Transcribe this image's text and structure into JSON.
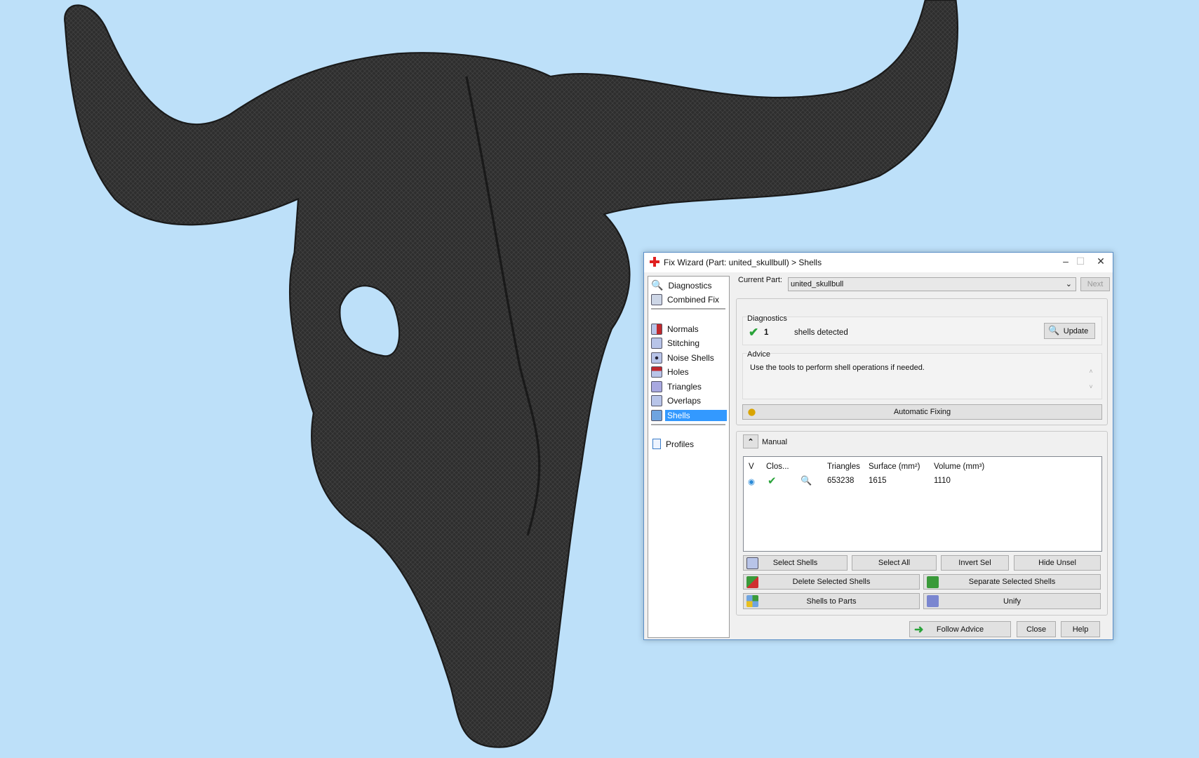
{
  "window": {
    "title": "Fix Wizard (Part: united_skullbull) > Shells",
    "minimize": "–",
    "maximize": "☐",
    "close": "✕"
  },
  "sidebar": {
    "items": [
      {
        "label": "Diagnostics",
        "icon": "magnifier-icon"
      },
      {
        "label": "Combined Fix",
        "icon": "cube-icon"
      },
      {
        "label": "Normals",
        "icon": "normals-icon"
      },
      {
        "label": "Stitching",
        "icon": "stitching-icon"
      },
      {
        "label": "Noise Shells",
        "icon": "noise-shells-icon"
      },
      {
        "label": "Holes",
        "icon": "holes-icon"
      },
      {
        "label": "Triangles",
        "icon": "triangles-icon"
      },
      {
        "label": "Overlaps",
        "icon": "overlaps-icon"
      },
      {
        "label": "Shells",
        "icon": "shells-icon",
        "selected": true
      },
      {
        "label": "Profiles",
        "icon": "document-icon"
      }
    ]
  },
  "header": {
    "current_part_label": "Current Part:",
    "current_part_value": "united_skullbull",
    "next": "Next"
  },
  "diagnostics": {
    "legend": "Diagnostics",
    "count": "1",
    "text": "shells detected",
    "update": "Update"
  },
  "advice": {
    "legend": "Advice",
    "text": "Use the tools to perform shell operations if needed."
  },
  "automatic_fixing": "Automatic Fixing",
  "manual": {
    "label": "Manual",
    "columns": [
      "V",
      "Clos...",
      "",
      "Triangles",
      "Surface (mm²)",
      "Volume (mm³)"
    ],
    "rows": [
      {
        "visible": true,
        "closed": true,
        "triangles": "653238",
        "surface": "1615",
        "volume": "1110"
      }
    ]
  },
  "buttons": {
    "select_shells": "Select Shells",
    "select_all": "Select All",
    "invert_sel": "Invert Sel",
    "hide_unsel": "Hide Unsel",
    "delete_selected": "Delete Selected Shells",
    "separate_selected": "Separate Selected Shells",
    "shells_to_parts": "Shells to Parts",
    "unify": "Unify",
    "follow_advice": "Follow Advice",
    "close": "Close",
    "help": "Help"
  },
  "colors": {
    "background": "#bde0f9",
    "selection": "#3399ff",
    "check": "#2aa33a"
  }
}
